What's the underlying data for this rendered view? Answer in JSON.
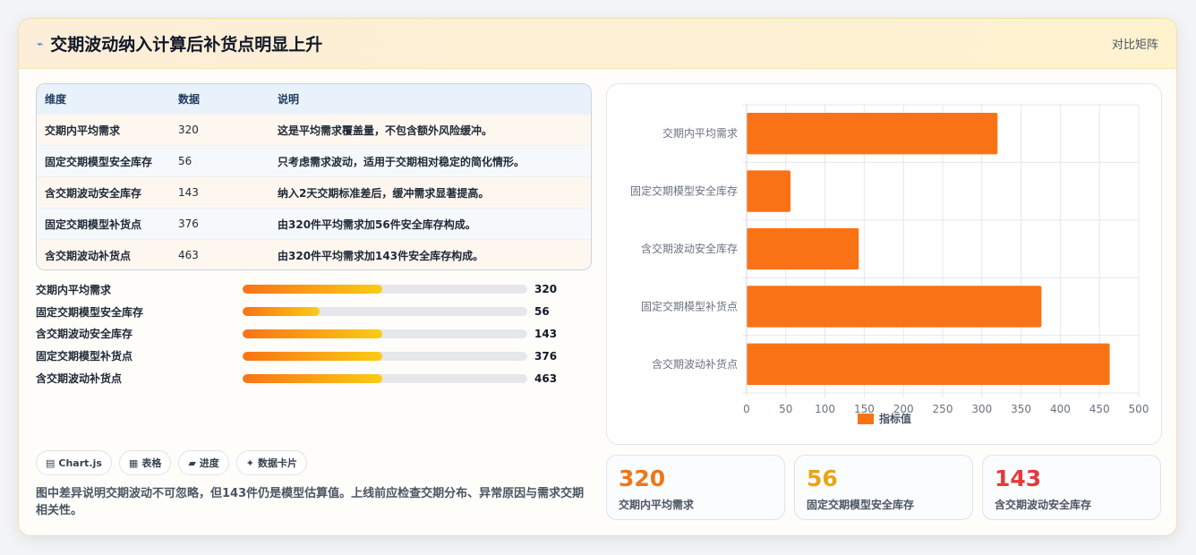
{
  "header": {
    "icon": "lightning-icon",
    "title": "交期波动纳入计算后补货点明显上升",
    "right_label": "对比矩阵"
  },
  "table": {
    "columns": [
      "维度",
      "数据",
      "说明"
    ],
    "rows": [
      [
        "交期内平均需求",
        "320",
        "这是平均需求覆盖量，不包含额外风险缓冲。"
      ],
      [
        "固定交期模型安全库存",
        "56",
        "只考虑需求波动，适用于交期相对稳定的简化情形。"
      ],
      [
        "含交期波动安全库存",
        "143",
        "纳入2天交期标准差后，缓冲需求显著提高。"
      ],
      [
        "固定交期模型补货点",
        "376",
        "由320件平均需求加56件安全库存构成。"
      ],
      [
        "含交期波动补货点",
        "463",
        "由320件平均需求加143件安全库存构成。"
      ]
    ]
  },
  "progress": [
    {
      "label": "交期内平均需求",
      "value": "320",
      "fill": 0.49
    },
    {
      "label": "固定交期模型安全库存",
      "value": "56",
      "fill": 0.27
    },
    {
      "label": "含交期波动安全库存",
      "value": "143",
      "fill": 0.49
    },
    {
      "label": "固定交期模型补货点",
      "value": "376",
      "fill": 0.49
    },
    {
      "label": "含交期波动补货点",
      "value": "463",
      "fill": 0.49
    }
  ],
  "chips": [
    {
      "icon": "chart-icon",
      "glyph": "▤",
      "label": "Chart.js"
    },
    {
      "icon": "table-icon",
      "glyph": "▦",
      "label": "表格"
    },
    {
      "icon": "progress-icon",
      "glyph": "▰",
      "label": "进度"
    },
    {
      "icon": "sparkle-icon",
      "glyph": "✦",
      "label": "数据卡片"
    }
  ],
  "note": "图中差异说明交期波动不可忽略，但143件仍是模型估算值。上线前应检查交期分布、异常原因与需求交期相关性。",
  "stats": [
    {
      "value": "320",
      "caption": "交期内平均需求",
      "color": "#f07716"
    },
    {
      "value": "56",
      "caption": "固定交期模型安全库存",
      "color": "#e9a514"
    },
    {
      "value": "143",
      "caption": "含交期波动安全库存",
      "color": "#e23b3b"
    }
  ],
  "chart_data": {
    "type": "bar",
    "orientation": "horizontal",
    "categories": [
      "交期内平均需求",
      "固定交期模型安全库存",
      "含交期波动安全库存",
      "固定交期模型补货点",
      "含交期波动补货点"
    ],
    "series": [
      {
        "name": "指标值",
        "values": [
          320,
          56,
          143,
          376,
          463
        ],
        "color": "#f97316"
      }
    ],
    "xlim": [
      0,
      500
    ],
    "xticks": [
      0,
      50,
      100,
      150,
      200,
      250,
      300,
      350,
      400,
      450,
      500
    ],
    "grid": true,
    "legend": "bottom"
  }
}
